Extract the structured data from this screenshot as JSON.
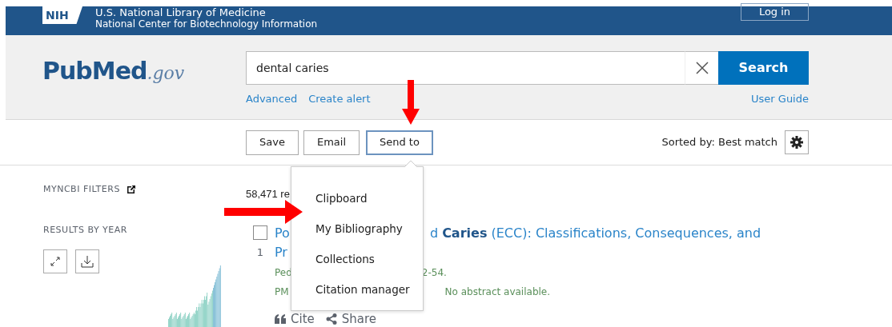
{
  "header": {
    "logo": "NIH",
    "org_line1": "U.S. National Library of Medicine",
    "org_line2": "National Center for Biotechnology Information",
    "login": "Log in"
  },
  "search": {
    "logo_main": "PubMed",
    "logo_suffix": ".gov",
    "value": "dental caries",
    "button": "Search",
    "links": [
      "Advanced",
      "Create alert"
    ],
    "guide": "User Guide"
  },
  "toolbar": {
    "buttons": [
      {
        "label": "Save",
        "selected": false
      },
      {
        "label": "Email",
        "selected": false
      },
      {
        "label": "Send to",
        "selected": true
      }
    ],
    "sort": "Sorted by: Best match"
  },
  "sidebar": {
    "filters": "MYNCBI FILTERS",
    "results_by_year": "RESULTS BY YEAR"
  },
  "send_menu": {
    "items": [
      "Clipboard",
      "My Bibliography",
      "Collections",
      "Citation manager"
    ]
  },
  "results": {
    "count": "58,471 re",
    "items": [
      {
        "checked": false,
        "number": "1",
        "title_start": "Po",
        "title_rest": "d **Caries** (ECC): Classifications, Consequences, and",
        "title_line2": "Pr",
        "journal_start": "Ped",
        "journal_end": "2-54.",
        "pmid_start": "PM",
        "abstract_note": "No abstract available.",
        "cite": "Cite",
        "share": "Share"
      }
    ]
  }
}
